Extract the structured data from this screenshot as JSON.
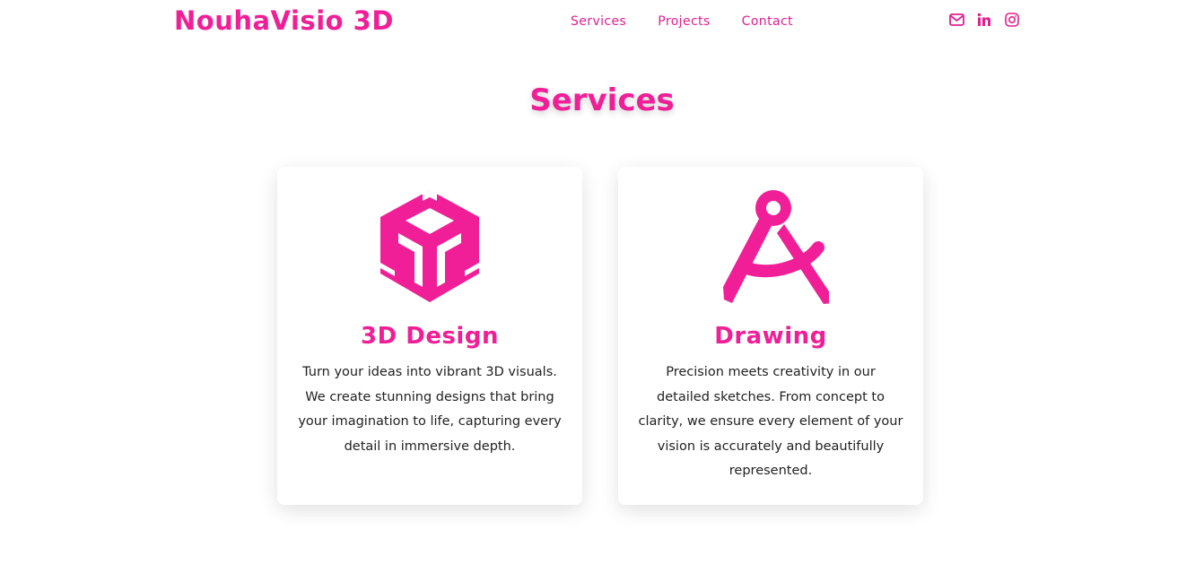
{
  "brand": {
    "logo": "NouhaVisio 3D",
    "accent_color": "#f01f97"
  },
  "nav": {
    "items": [
      {
        "label": "Services"
      },
      {
        "label": "Projects"
      },
      {
        "label": "Contact"
      }
    ]
  },
  "social": {
    "icons": [
      "envelope-icon",
      "linkedin-icon",
      "instagram-icon"
    ]
  },
  "services": {
    "title": "Services",
    "cards": [
      {
        "icon": "unity-cube-icon",
        "title": "3D Design",
        "description": "Turn your ideas into vibrant 3D visuals. We create stunning designs that bring your imagination to life, capturing every detail in immersive depth."
      },
      {
        "icon": "drafting-compass-icon",
        "title": "Drawing",
        "description": "Precision meets creativity in our detailed sketches. From concept to clarity, we ensure every element of your vision is accurately and beautifully represented."
      }
    ]
  }
}
